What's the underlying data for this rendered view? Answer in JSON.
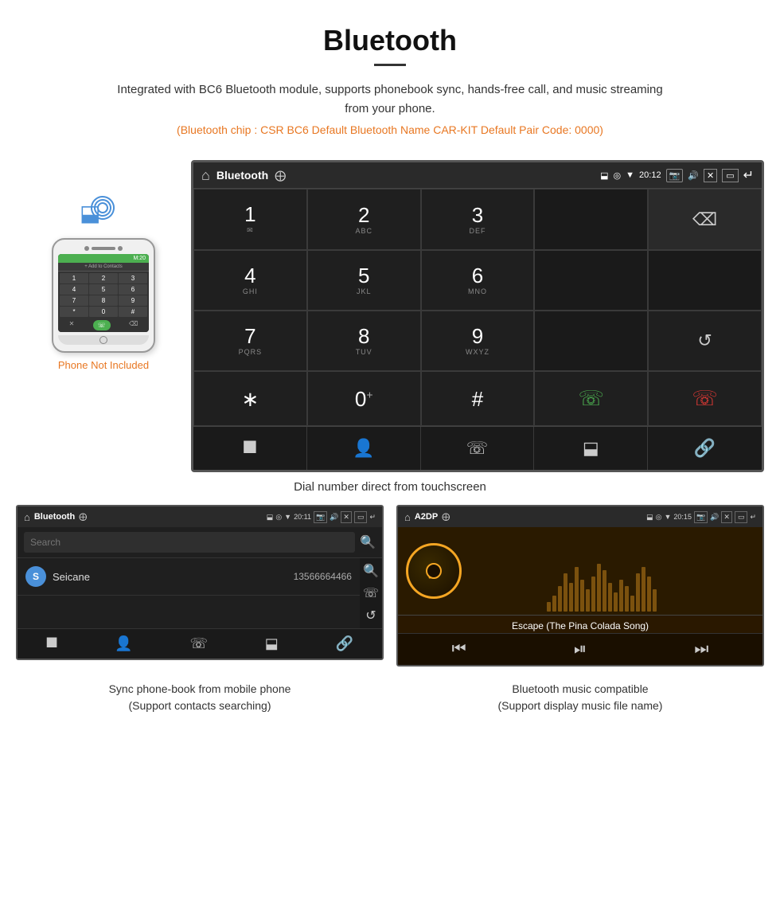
{
  "header": {
    "title": "Bluetooth",
    "description": "Integrated with BC6 Bluetooth module, supports phonebook sync, hands-free call, and music streaming from your phone.",
    "specs": "(Bluetooth chip : CSR BC6   Default Bluetooth Name CAR-KIT    Default Pair Code: 0000)"
  },
  "phone_label": "Phone Not Included",
  "dialpad_screen": {
    "title": "Bluetooth",
    "time": "20:12",
    "keys": [
      {
        "num": "1",
        "sub": ""
      },
      {
        "num": "2",
        "sub": "ABC"
      },
      {
        "num": "3",
        "sub": "DEF"
      },
      {
        "num": "4",
        "sub": "GHI"
      },
      {
        "num": "5",
        "sub": "JKL"
      },
      {
        "num": "6",
        "sub": "MNO"
      },
      {
        "num": "7",
        "sub": "PQRS"
      },
      {
        "num": "8",
        "sub": "TUV"
      },
      {
        "num": "9",
        "sub": "WXYZ"
      },
      {
        "num": "*",
        "sub": ""
      },
      {
        "num": "0",
        "sub": "+"
      },
      {
        "num": "#",
        "sub": ""
      }
    ]
  },
  "dialpad_caption": "Dial number direct from touchscreen",
  "phonebook_screen": {
    "title": "Bluetooth",
    "time": "20:11",
    "search_placeholder": "Search",
    "contact": {
      "initial": "S",
      "name": "Seicane",
      "phone": "13566664466"
    }
  },
  "a2dp_screen": {
    "title": "A2DP",
    "time": "20:15",
    "song_title": "Escape (The Pina Colada Song)"
  },
  "phonebook_caption_line1": "Sync phone-book from mobile phone",
  "phonebook_caption_line2": "(Support contacts searching)",
  "a2dp_caption_line1": "Bluetooth music compatible",
  "a2dp_caption_line2": "(Support display music file name)",
  "watermark": "Seicane",
  "viz_bars": [
    3,
    5,
    8,
    12,
    9,
    14,
    10,
    7,
    11,
    15,
    13,
    9,
    6,
    10,
    8,
    5,
    12,
    14,
    11,
    7
  ]
}
